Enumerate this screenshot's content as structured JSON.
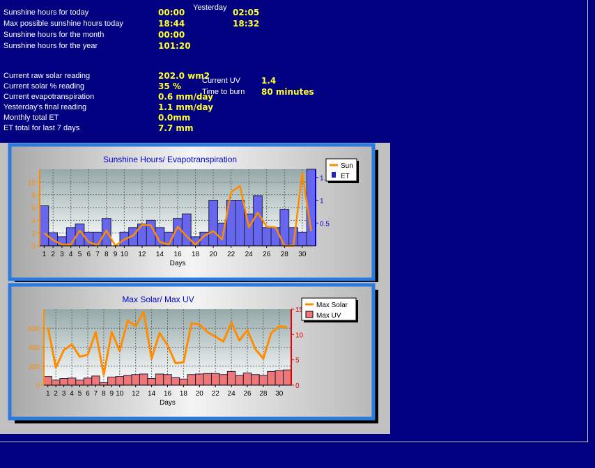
{
  "stats": {
    "yesterday_label": "Yesterday",
    "rows1": [
      {
        "label": "Sunshine hours for today",
        "value": "00:00",
        "yesterday": "02:05"
      },
      {
        "label": "Max possible sunshine hours today",
        "value": "18:44",
        "yesterday": "18:32"
      },
      {
        "label": "Sunshine hours for the month",
        "value": "00:00"
      },
      {
        "label": "Sunshine hours for the year",
        "value": "101:20"
      }
    ],
    "rows2": [
      {
        "label": "Current raw solar reading",
        "value": "202.0 wm2"
      },
      {
        "label": "Current solar % reading",
        "value": "35 %"
      },
      {
        "label": "Current evapotranspiration",
        "value": "0.6 mm/day"
      },
      {
        "label": "Yesterday's final reading",
        "value": "1.1 mm/day"
      },
      {
        "label": "Monthly total ET",
        "value": "0.0mm"
      },
      {
        "label": "ET total for last 7 days",
        "value": "7.7 mm"
      }
    ],
    "uv_label": "Current UV",
    "uv_value": "1.4",
    "burn_label": "Time to burn",
    "burn_value": "80 minutes"
  },
  "colors": {
    "background": "#000080",
    "stat_value": "#ffff33",
    "sun_line": "#ff8c00",
    "et_bar": "#6666ee",
    "max_uv_bar": "#ee7777",
    "title": "#0000cc",
    "frame": "#2a7adf"
  },
  "chart_data": [
    {
      "type": "bar",
      "title": "Sunshine Hours/ Evapotranspiration",
      "xlabel": "Days",
      "ylabel": "",
      "x": [
        1,
        2,
        3,
        4,
        5,
        6,
        7,
        8,
        9,
        10,
        11,
        12,
        13,
        14,
        15,
        16,
        17,
        18,
        19,
        20,
        21,
        22,
        23,
        24,
        25,
        26,
        27,
        28,
        29,
        30,
        31
      ],
      "x_tick_labels": [
        "1",
        "2",
        "3",
        "4",
        "5",
        "6",
        "7",
        "8",
        "9",
        "10",
        "12",
        "14",
        "16",
        "18",
        "20",
        "22",
        "24",
        "26",
        "28",
        "30"
      ],
      "xlim": [
        0.5,
        31.5
      ],
      "ylim": [
        0,
        12
      ],
      "yticks": [
        0,
        2,
        4,
        6,
        8,
        10
      ],
      "y2lim": [
        0,
        1.68
      ],
      "y2ticks": [
        0.5,
        1,
        1.5
      ],
      "grid": true,
      "legend_position": "top-right",
      "series": [
        {
          "name": "Sun",
          "kind": "line",
          "axis": "left",
          "values": [
            2.0,
            0.9,
            0.2,
            0.2,
            2.4,
            0.6,
            0.1,
            2.4,
            0.0,
            1.0,
            1.6,
            3.3,
            3.2,
            0.6,
            0.2,
            3.0,
            1.5,
            0.2,
            1.6,
            2.3,
            1.0,
            8.4,
            9.4,
            2.9,
            5.2,
            3.0,
            2.9,
            0.0,
            0.0,
            11.4,
            2.3
          ]
        },
        {
          "name": "ET",
          "kind": "bar",
          "axis": "right",
          "values": [
            0.88,
            0.29,
            0.2,
            0.4,
            0.48,
            0.3,
            0.3,
            0.6,
            0.0,
            0.3,
            0.4,
            0.48,
            0.56,
            0.4,
            0.3,
            0.6,
            0.7,
            0.2,
            0.3,
            1.0,
            0.5,
            1.0,
            1.0,
            0.7,
            1.1,
            0.4,
            0.4,
            0.8,
            0.4,
            0.3,
            1.68
          ]
        }
      ]
    },
    {
      "type": "bar",
      "title": "Max Solar/ Max UV",
      "xlabel": "Days",
      "ylabel": "",
      "x": [
        1,
        2,
        3,
        4,
        5,
        6,
        7,
        8,
        9,
        10,
        11,
        12,
        13,
        14,
        15,
        16,
        17,
        18,
        19,
        20,
        21,
        22,
        23,
        24,
        25,
        26,
        27,
        28,
        29,
        30,
        31
      ],
      "x_tick_labels": [
        "1",
        "2",
        "3",
        "4",
        "5",
        "6",
        "7",
        "8",
        "9",
        "10",
        "12",
        "14",
        "16",
        "18",
        "20",
        "22",
        "24",
        "26",
        "28",
        "30"
      ],
      "xlim": [
        0.5,
        31.5
      ],
      "ylim": [
        0,
        800
      ],
      "yticks": [
        0,
        200,
        400,
        600
      ],
      "y2lim": [
        0,
        15
      ],
      "y2ticks": [
        0,
        5,
        10,
        15
      ],
      "grid": true,
      "legend_position": "top-right",
      "series": [
        {
          "name": "Max Solar",
          "kind": "line",
          "axis": "left",
          "values": [
            610,
            185,
            370,
            430,
            300,
            320,
            560,
            110,
            560,
            360,
            680,
            620,
            770,
            280,
            550,
            420,
            230,
            240,
            650,
            640,
            560,
            510,
            460,
            660,
            470,
            580,
            380,
            280,
            550,
            620,
            610
          ]
        },
        {
          "name": "Max UV",
          "kind": "bar",
          "axis": "right",
          "values": [
            1.7,
            1.0,
            1.3,
            1.4,
            1.0,
            1.4,
            1.8,
            0.5,
            1.6,
            1.7,
            1.9,
            2.1,
            2.2,
            1.3,
            2.2,
            2.1,
            1.5,
            1.2,
            2.1,
            2.2,
            2.3,
            2.3,
            2.1,
            2.7,
            1.9,
            2.4,
            2.1,
            1.9,
            2.7,
            2.9,
            3.0
          ]
        }
      ]
    }
  ]
}
